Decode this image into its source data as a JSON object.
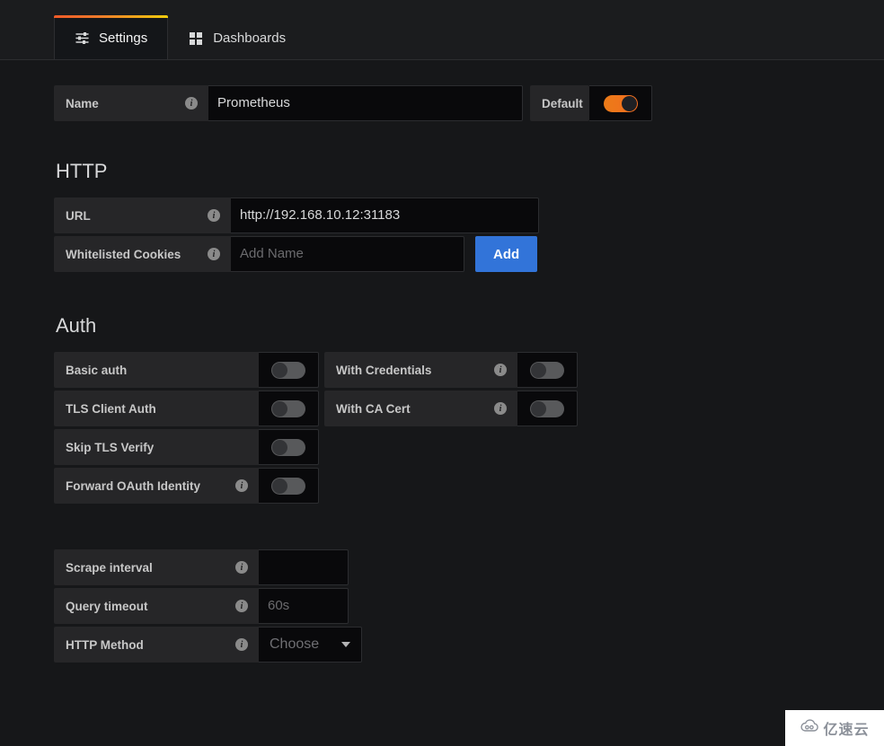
{
  "tabs": [
    {
      "label": "Settings",
      "icon": "sliders-icon",
      "active": true
    },
    {
      "label": "Dashboards",
      "icon": "grid-apps-icon",
      "active": false
    }
  ],
  "name_row": {
    "label": "Name",
    "info": "i",
    "value": "Prometheus",
    "default_label": "Default",
    "default_toggle_state": "on"
  },
  "http": {
    "title": "HTTP",
    "url": {
      "label": "URL",
      "info": "i",
      "value": "http://192.168.10.12:31183"
    },
    "cookies": {
      "label": "Whitelisted Cookies",
      "info": "i",
      "value": "",
      "placeholder": "Add Name",
      "add_button": "Add"
    }
  },
  "auth": {
    "title": "Auth",
    "left_rows": [
      {
        "label": "Basic auth",
        "info": "",
        "state": "off"
      },
      {
        "label": "TLS Client Auth",
        "info": "",
        "state": "off"
      },
      {
        "label": "Skip TLS Verify",
        "info": "",
        "state": "off"
      },
      {
        "label": "Forward OAuth Identity",
        "info": "i",
        "state": "off"
      }
    ],
    "right_rows": [
      {
        "label": "With Credentials",
        "info": "i",
        "state": "off"
      },
      {
        "label": "With CA Cert",
        "info": "i",
        "state": "off"
      }
    ]
  },
  "query_options": [
    {
      "label": "Scrape interval",
      "info": "i",
      "value": "",
      "placeholder": "",
      "type": "input"
    },
    {
      "label": "Query timeout",
      "info": "i",
      "value": "",
      "placeholder": "60s",
      "type": "input"
    },
    {
      "label": "HTTP Method",
      "info": "i",
      "value": "Choose",
      "type": "select"
    }
  ],
  "watermark": {
    "text": "亿速云"
  },
  "colors": {
    "background": "#161719",
    "panel": "#1b1c1e",
    "label_bg": "#262628",
    "input_bg": "#09090b",
    "accent_orange": "#eb7b18",
    "accent_blue": "#3274d9",
    "tab_gradient_start": "#f05a28",
    "tab_gradient_end": "#f2cc0c"
  }
}
